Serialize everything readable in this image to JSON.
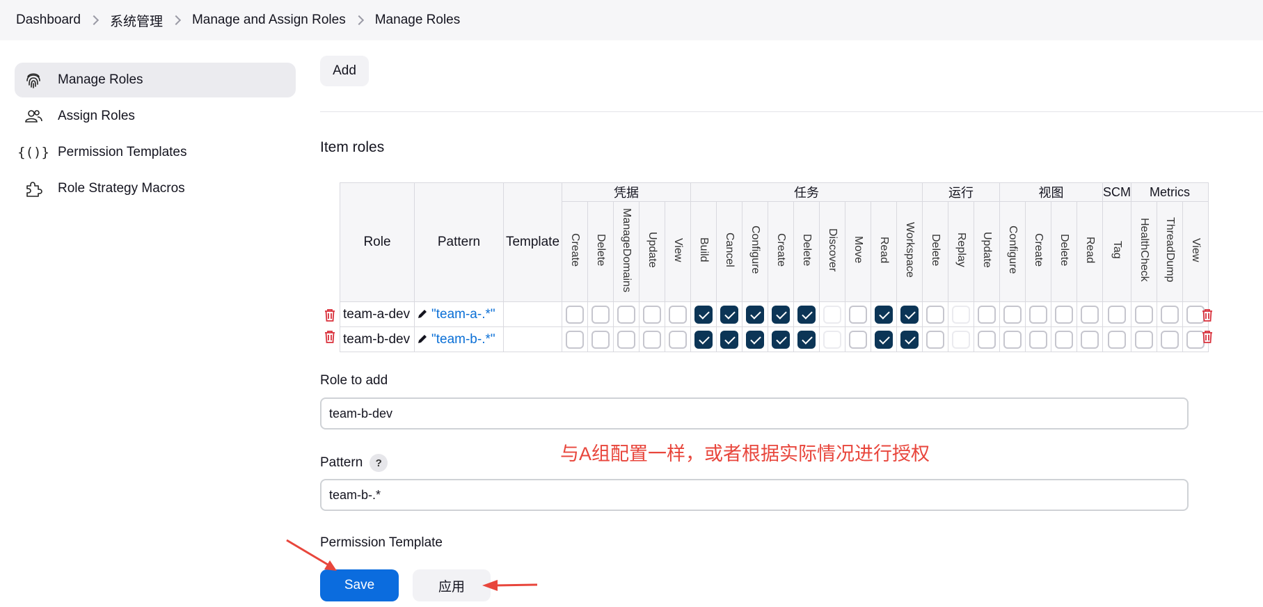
{
  "breadcrumb": [
    "Dashboard",
    "系统管理",
    "Manage and Assign Roles",
    "Manage Roles"
  ],
  "sidebar": {
    "items": [
      {
        "label": "Manage Roles",
        "icon": "fingerprint-icon",
        "active": true
      },
      {
        "label": "Assign Roles",
        "icon": "users-icon",
        "active": false
      },
      {
        "label": "Permission Templates",
        "icon": "braces-icon",
        "active": false
      },
      {
        "label": "Role Strategy Macros",
        "icon": "puzzle-icon",
        "active": false
      }
    ]
  },
  "main": {
    "add_label": "Add",
    "section_title": "Item roles",
    "table": {
      "headers": {
        "role": "Role",
        "pattern": "Pattern",
        "template": "Template"
      },
      "groups": [
        {
          "name": "凭据",
          "perms": [
            "Create",
            "Delete",
            "ManageDomains",
            "Update",
            "View"
          ]
        },
        {
          "name": "任务",
          "perms": [
            "Build",
            "Cancel",
            "Configure",
            "Create",
            "Delete",
            "Discover",
            "Move",
            "Read",
            "Workspace"
          ]
        },
        {
          "name": "运行",
          "perms": [
            "Delete",
            "Replay",
            "Update"
          ]
        },
        {
          "name": "视图",
          "perms": [
            "Configure",
            "Create",
            "Delete",
            "Read"
          ]
        },
        {
          "name": "SCM",
          "perms": [
            "Tag"
          ]
        },
        {
          "name": "Metrics",
          "perms": [
            "HealthCheck",
            "ThreadDump",
            "View"
          ]
        }
      ],
      "rows": [
        {
          "role": "team-a-dev",
          "pattern": "\"team-a-.*\"",
          "template": "",
          "checked": [
            false,
            false,
            false,
            false,
            false,
            true,
            true,
            true,
            true,
            true,
            false,
            false,
            true,
            true,
            false,
            false,
            false,
            false,
            false,
            false,
            false,
            false,
            false,
            false,
            false
          ]
        },
        {
          "role": "team-b-dev",
          "pattern": "\"team-b-.*\"",
          "template": "",
          "checked": [
            false,
            false,
            false,
            false,
            false,
            true,
            true,
            true,
            true,
            true,
            false,
            false,
            true,
            true,
            false,
            false,
            false,
            false,
            false,
            false,
            false,
            false,
            false,
            false,
            false
          ]
        }
      ]
    },
    "role_to_add_label": "Role to add",
    "role_to_add_value": "team-b-dev",
    "pattern_label": "Pattern",
    "pattern_help": "?",
    "pattern_value": "team-b-.*",
    "permission_template_label": "Permission Template",
    "annotation_text": "与A组配置一样，或者根据实际情况进行授权",
    "save_label": "Save",
    "apply_label": "应用"
  },
  "colors": {
    "checked": "#0c3556",
    "save": "#0b6cde",
    "danger": "#d9303b",
    "annotation": "#e8463c",
    "link": "#0a6fd6"
  }
}
